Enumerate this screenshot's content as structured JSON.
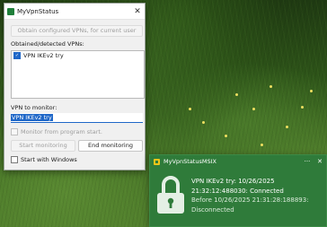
{
  "window": {
    "title": "MyVpnStatus",
    "close_glyph": "✕",
    "obtain_button": "Obtain configured VPNs, for current user",
    "obtained_label": "Obtained/detected VPNs:",
    "vpn_list": [
      {
        "label": "VPN IKEv2 try",
        "checked": true
      }
    ],
    "vpn_to_monitor_label": "VPN to monitor:",
    "vpn_to_monitor_value": "VPN IKEv2 try",
    "monitor_from_program_start": "Monitor from program start.",
    "start_monitoring": "Start monitoring",
    "end_monitoring": "End monitoring",
    "start_with_windows": "Start with Windows"
  },
  "toast": {
    "app_name": "MyVpnStatusMSIX",
    "more_glyph": "···",
    "close_glyph": "✕",
    "line1": "VPN IKEv2 try: 10/26/2025",
    "line2": "21:32:12:488030: Connected",
    "line3": "Before 10/26/2025 21:31:28:188893:",
    "line4": "Disconnected",
    "icon": "lock-icon"
  },
  "colors": {
    "accent": "#1f67c8",
    "toast_background": "#2f7b3a"
  }
}
